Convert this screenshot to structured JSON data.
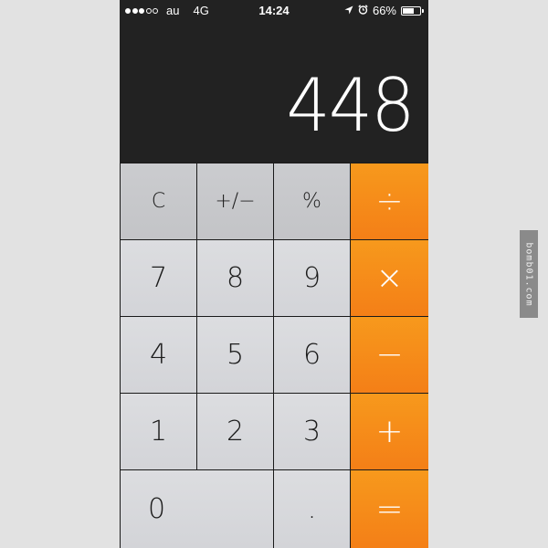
{
  "status_bar": {
    "signal_dots_filled": 3,
    "signal_dots_total": 5,
    "carrier": "au",
    "network": "4G",
    "time": "14:24",
    "battery_text": "66%",
    "battery_level": 0.66,
    "icons": [
      "location-arrow-icon",
      "alarm-clock-icon",
      "battery-icon"
    ]
  },
  "display": {
    "value": "448"
  },
  "keys": {
    "clear": "C",
    "plus_minus": "+/−",
    "percent": "%",
    "divide": "÷",
    "seven": "7",
    "eight": "8",
    "nine": "9",
    "multiply": "×",
    "four": "4",
    "five": "5",
    "six": "6",
    "minus": "−",
    "one": "1",
    "two": "2",
    "three": "3",
    "plus": "+",
    "zero": "0",
    "decimal": ".",
    "equals": "="
  },
  "watermark": "bomb01.com",
  "colors": {
    "operator": "#f58a19",
    "display_bg": "#222222",
    "key_light": "#d8d9dc",
    "key_function": "#c8c9cc"
  }
}
